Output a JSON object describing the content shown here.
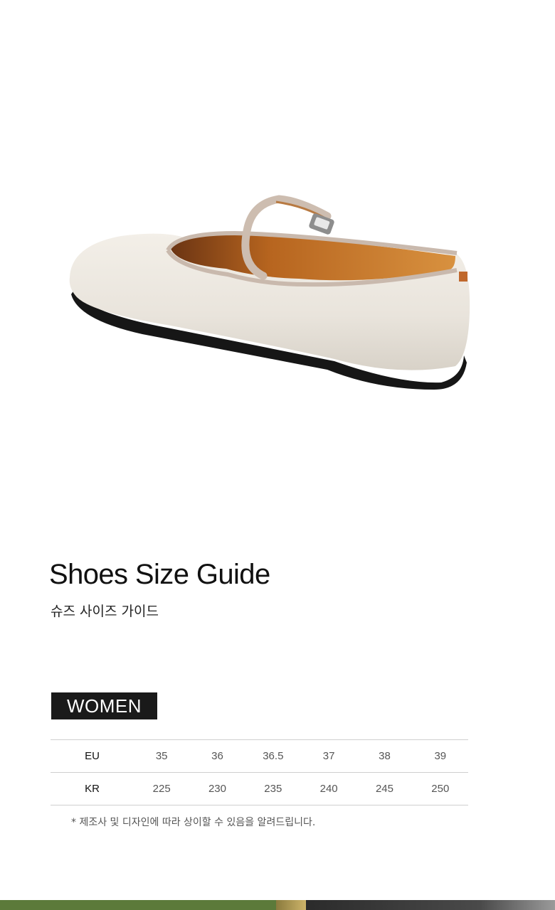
{
  "guide": {
    "title": "Shoes Size Guide",
    "subtitle": "슈즈 사이즈 가이드"
  },
  "category": {
    "label": "WOMEN"
  },
  "size_table": {
    "rows": [
      {
        "label": "EU",
        "values": [
          "35",
          "36",
          "36.5",
          "37",
          "38",
          "39"
        ]
      },
      {
        "label": "KR",
        "values": [
          "225",
          "230",
          "235",
          "240",
          "245",
          "250"
        ]
      }
    ]
  },
  "note": "* 제조사 및 디자인에 따라 상이할 수 있음을 알려드립니다.",
  "colors": {
    "background": "#ffffff",
    "tag_background": "#1a1a1a",
    "shoe_leather": "#ece7df",
    "shoe_lining": "#c97a2f",
    "strip_green": "#5c7a3a"
  }
}
